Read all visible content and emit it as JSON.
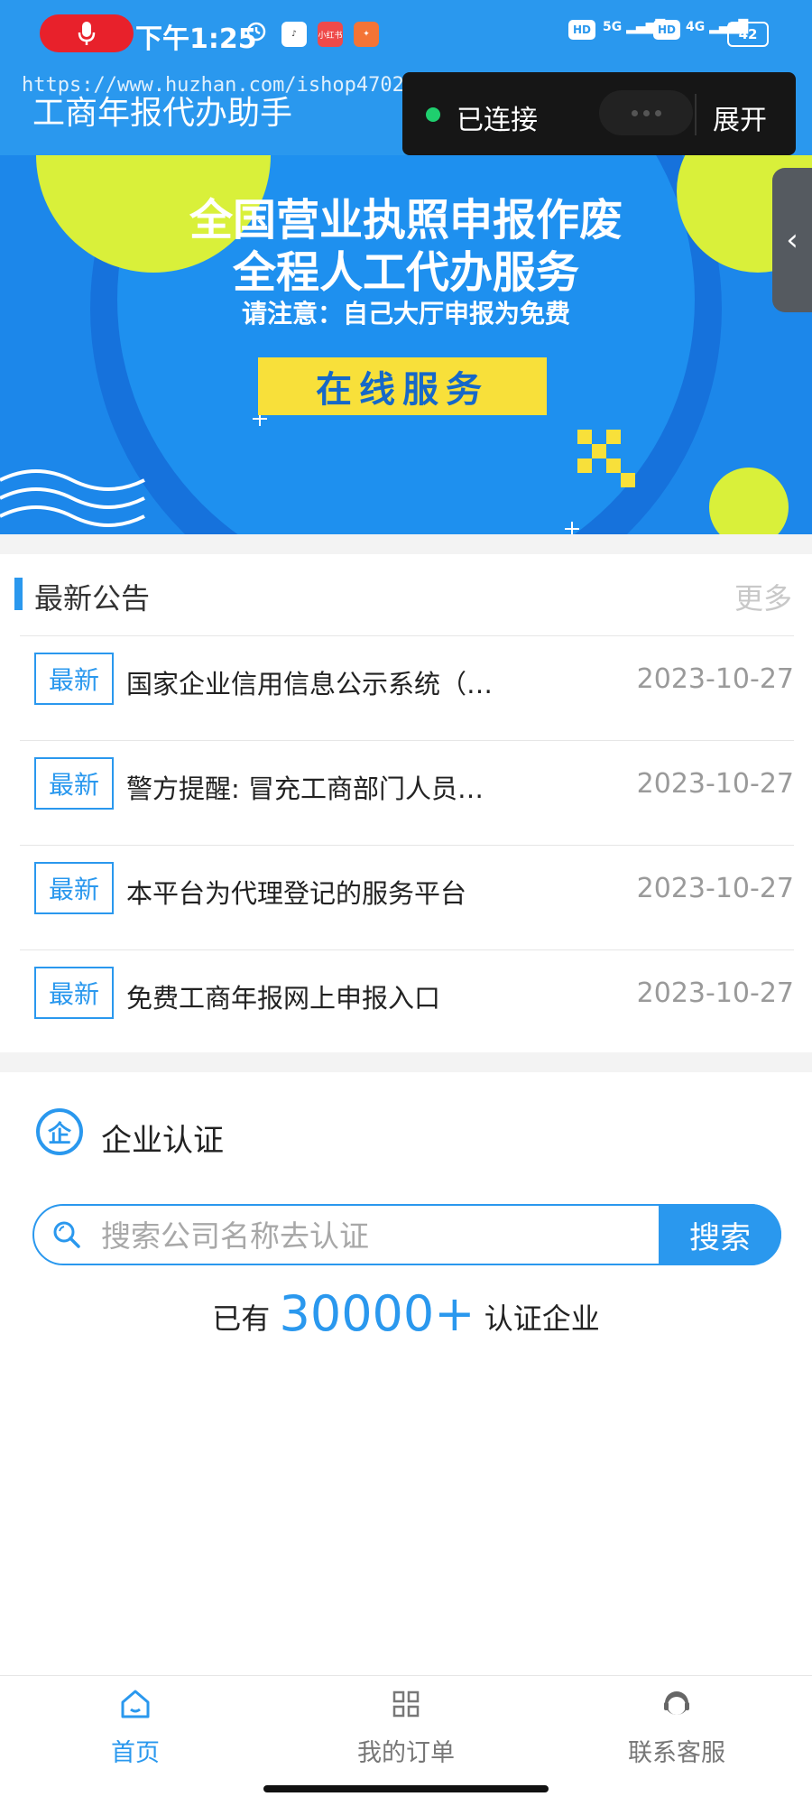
{
  "status_bar": {
    "time": "下午1:25",
    "app_icon_2": "小红书",
    "network_1_hd": "HD",
    "network_1": "5G",
    "network_2_hd": "HD",
    "network_2": "4G",
    "battery": "42"
  },
  "header": {
    "title": "工商年报代办助手",
    "watermark": "https://www.huzhan.com/ishop47020"
  },
  "connection": {
    "status": "已连接",
    "expand_label": "展开",
    "status_color": "#1fcf6e"
  },
  "banner": {
    "line1": "全国营业执照申报作废",
    "line2": "全程人工代办服务",
    "line3": "请注意：自己大厅申报为免费",
    "button": "在线服务",
    "handle_icon": "chevron-left-icon"
  },
  "notices": {
    "title": "最新公告",
    "more": "更多",
    "items": [
      {
        "badge": "最新",
        "text": "国家企业信用信息公示系统（…",
        "date": "2023-10-27"
      },
      {
        "badge": "最新",
        "text": "警方提醒: 冒充工商部门人员…",
        "date": "2023-10-27"
      },
      {
        "badge": "最新",
        "text": "本平台为代理登记的服务平台",
        "date": "2023-10-27"
      },
      {
        "badge": "最新",
        "text": "免费工商年报网上申报入口",
        "date": "2023-10-27"
      }
    ]
  },
  "certification": {
    "icon_char": "企",
    "title": "企业认证",
    "search_placeholder": "搜索公司名称去认证",
    "search_button": "搜索",
    "count_prefix": "已有",
    "count_value": "30000+",
    "count_suffix": "认证企业"
  },
  "nav": {
    "items": [
      {
        "label": "首页",
        "icon": "home-icon",
        "active": true
      },
      {
        "label": "我的订单",
        "icon": "grid-icon",
        "active": false
      },
      {
        "label": "联系客服",
        "icon": "customer-service-icon",
        "active": false
      }
    ]
  },
  "colors": {
    "primary": "#2a98ee",
    "inactive_nav": "#777777",
    "banner_button": "#f8e03a"
  }
}
